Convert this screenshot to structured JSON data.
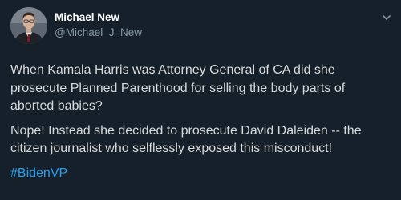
{
  "author": {
    "name": "Michael New",
    "handle": "@Michael_J_New",
    "avatar_icon": "profile-photo"
  },
  "menu_icon": "chevron-down-icon",
  "tweet": {
    "paragraph1": "When Kamala Harris was Attorney General of CA did she\nprosecute Planned Parenthood for selling the body parts of\naborted babies?",
    "paragraph2": "Nope! Instead she decided to prosecute David Daleiden -- the\ncitizen journalist who selflessly exposed this misconduct!",
    "hashtag": "#BidenVP"
  },
  "colors": {
    "background": "#15202b",
    "name": "#ffffff",
    "handle": "#8899a6",
    "text": "#d9d9d9",
    "hashtag": "#1da1f2"
  }
}
